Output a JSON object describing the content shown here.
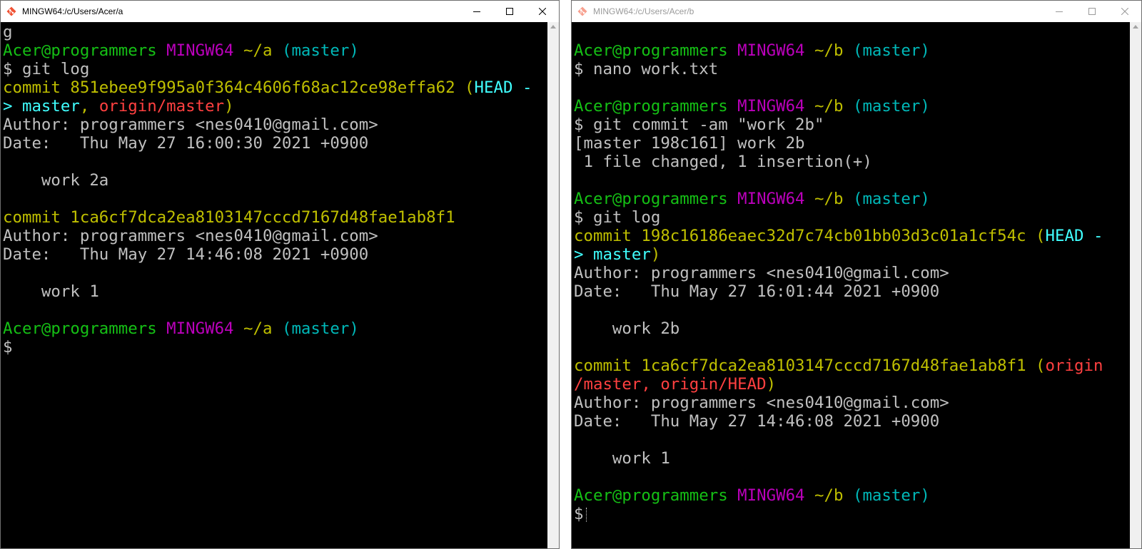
{
  "colors": {
    "user_host": "#15c015",
    "msystem": "#bb00bb",
    "path": "#bfbf00",
    "branch": "#00b8b8",
    "head": "#40ffff",
    "remote": "#ff4040",
    "text": "#c0c0c0",
    "commit": "#bfbf00"
  },
  "window_a": {
    "title": "MINGW64:/c/Users/Acer/a",
    "icon": "git-bash-icon",
    "controls": [
      "minimize-icon",
      "maximize-icon",
      "close-icon"
    ],
    "lines": [
      [
        [
          "g",
          "w"
        ]
      ],
      [
        [
          "Acer@programmers",
          "g"
        ],
        [
          " ",
          "w"
        ],
        [
          "MINGW64",
          "m"
        ],
        [
          " ",
          "w"
        ],
        [
          "~/a",
          "y"
        ],
        [
          " ",
          "w"
        ],
        [
          "(master)",
          "c"
        ]
      ],
      [
        [
          "$ git log",
          "w"
        ]
      ],
      [
        [
          "commit 851ebee9f995a0f364c4606f68ac12ce98effa62 (",
          "y"
        ],
        [
          "HEAD -",
          "hc"
        ]
      ],
      [
        [
          "> master",
          "hc"
        ],
        [
          ", ",
          "y"
        ],
        [
          "origin/master",
          "r"
        ],
        [
          ")",
          "y"
        ]
      ],
      [
        [
          "Author: programmers <nes0410@gmail.com>",
          "w"
        ]
      ],
      [
        [
          "Date:   Thu May 27 16:00:30 2021 +0900",
          "w"
        ]
      ],
      [
        [
          "",
          "w"
        ]
      ],
      [
        [
          "    work 2a",
          "w"
        ]
      ],
      [
        [
          "",
          "w"
        ]
      ],
      [
        [
          "commit 1ca6cf7dca2ea8103147cccd7167d48fae1ab8f1",
          "y"
        ]
      ],
      [
        [
          "Author: programmers <nes0410@gmail.com>",
          "w"
        ]
      ],
      [
        [
          "Date:   Thu May 27 14:46:08 2021 +0900",
          "w"
        ]
      ],
      [
        [
          "",
          "w"
        ]
      ],
      [
        [
          "    work 1",
          "w"
        ]
      ],
      [
        [
          "",
          "w"
        ]
      ],
      [
        [
          "Acer@programmers",
          "g"
        ],
        [
          " ",
          "w"
        ],
        [
          "MINGW64",
          "m"
        ],
        [
          " ",
          "w"
        ],
        [
          "~/a",
          "y"
        ],
        [
          " ",
          "w"
        ],
        [
          "(master)",
          "c"
        ]
      ],
      [
        [
          "$",
          "w"
        ]
      ]
    ]
  },
  "window_b": {
    "title": "MINGW64:/c/Users/Acer/b",
    "icon": "git-bash-icon",
    "controls": [
      "minimize-icon",
      "maximize-icon",
      "close-icon"
    ],
    "lines": [
      [
        [
          "",
          "w"
        ]
      ],
      [
        [
          "Acer@programmers",
          "g"
        ],
        [
          " ",
          "w"
        ],
        [
          "MINGW64",
          "m"
        ],
        [
          " ",
          "w"
        ],
        [
          "~/b",
          "y"
        ],
        [
          " ",
          "w"
        ],
        [
          "(master)",
          "c"
        ]
      ],
      [
        [
          "$ nano work.txt",
          "w"
        ]
      ],
      [
        [
          "",
          "w"
        ]
      ],
      [
        [
          "Acer@programmers",
          "g"
        ],
        [
          " ",
          "w"
        ],
        [
          "MINGW64",
          "m"
        ],
        [
          " ",
          "w"
        ],
        [
          "~/b",
          "y"
        ],
        [
          " ",
          "w"
        ],
        [
          "(master)",
          "c"
        ]
      ],
      [
        [
          "$ git commit -am \"work 2b\"",
          "w"
        ]
      ],
      [
        [
          "[master 198c161] work 2b",
          "w"
        ]
      ],
      [
        [
          " 1 file changed, 1 insertion(+)",
          "w"
        ]
      ],
      [
        [
          "",
          "w"
        ]
      ],
      [
        [
          "Acer@programmers",
          "g"
        ],
        [
          " ",
          "w"
        ],
        [
          "MINGW64",
          "m"
        ],
        [
          " ",
          "w"
        ],
        [
          "~/b",
          "y"
        ],
        [
          " ",
          "w"
        ],
        [
          "(master)",
          "c"
        ]
      ],
      [
        [
          "$ git log",
          "w"
        ]
      ],
      [
        [
          "commit 198c16186eaec32d7c74cb01bb03d3c01a1cf54c (",
          "y"
        ],
        [
          "HEAD -",
          "hc"
        ]
      ],
      [
        [
          "> master",
          "hc"
        ],
        [
          ")",
          "y"
        ]
      ],
      [
        [
          "Author: programmers <nes0410@gmail.com>",
          "w"
        ]
      ],
      [
        [
          "Date:   Thu May 27 16:01:44 2021 +0900",
          "w"
        ]
      ],
      [
        [
          "",
          "w"
        ]
      ],
      [
        [
          "    work 2b",
          "w"
        ]
      ],
      [
        [
          "",
          "w"
        ]
      ],
      [
        [
          "commit 1ca6cf7dca2ea8103147cccd7167d48fae1ab8f1 (",
          "y"
        ],
        [
          "origin",
          "r"
        ]
      ],
      [
        [
          "/master, origin/HEAD",
          "r"
        ],
        [
          ")",
          "y"
        ]
      ],
      [
        [
          "Author: programmers <nes0410@gmail.com>",
          "w"
        ]
      ],
      [
        [
          "Date:   Thu May 27 14:46:08 2021 +0900",
          "w"
        ]
      ],
      [
        [
          "",
          "w"
        ]
      ],
      [
        [
          "    work 1",
          "w"
        ]
      ],
      [
        [
          "",
          "w"
        ]
      ],
      [
        [
          "Acer@programmers",
          "g"
        ],
        [
          " ",
          "w"
        ],
        [
          "MINGW64",
          "m"
        ],
        [
          " ",
          "w"
        ],
        [
          "~/b",
          "y"
        ],
        [
          " ",
          "w"
        ],
        [
          "(master)",
          "c"
        ]
      ],
      [
        [
          "$",
          "w"
        ]
      ]
    ]
  }
}
